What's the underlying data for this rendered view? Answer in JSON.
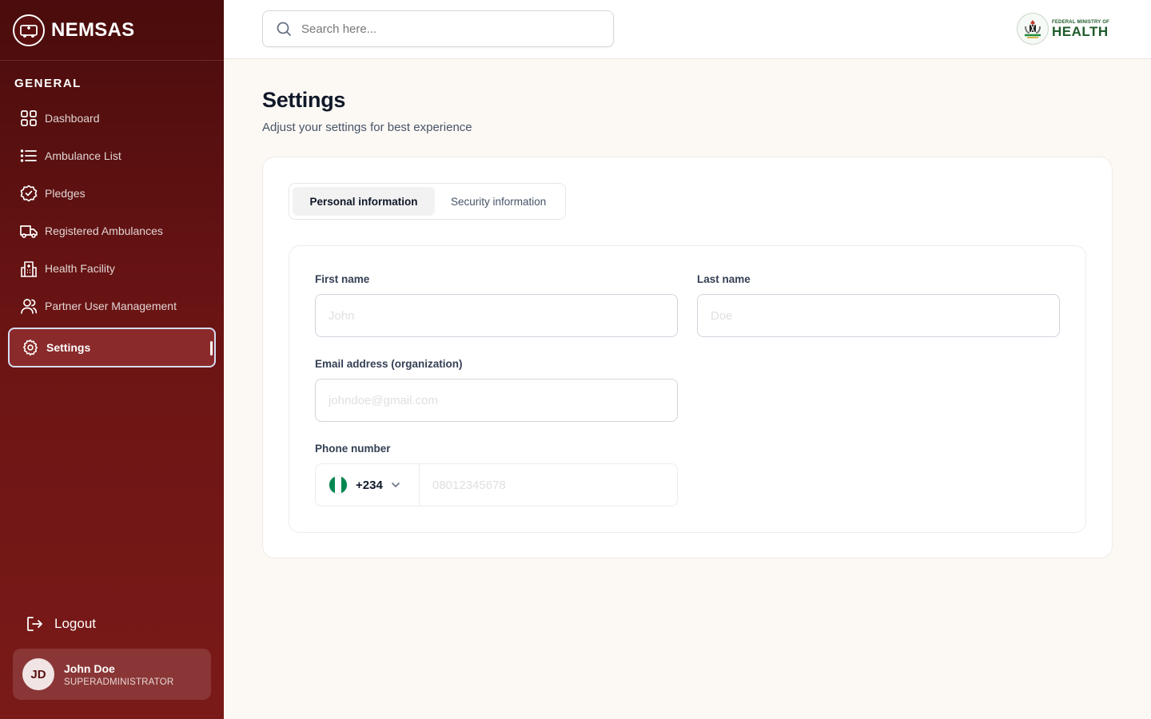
{
  "brand": {
    "name": "NEMSAS"
  },
  "sidebar": {
    "section_title": "GENERAL",
    "items": [
      {
        "label": "Dashboard",
        "icon": "grid-icon"
      },
      {
        "label": "Ambulance List",
        "icon": "list-icon"
      },
      {
        "label": "Pledges",
        "icon": "badge-check-icon"
      },
      {
        "label": "Registered Ambulances",
        "icon": "truck-icon"
      },
      {
        "label": "Health Facility",
        "icon": "building-icon"
      },
      {
        "label": "Partner User Management",
        "icon": "users-icon"
      },
      {
        "label": "Settings",
        "icon": "gear-icon",
        "active": true
      }
    ],
    "logout_label": "Logout",
    "user": {
      "initials": "JD",
      "name": "John Doe",
      "role": "SUPERADMINISTRATOR"
    }
  },
  "header": {
    "search_placeholder": "Search here...",
    "ministry_small": "FEDERAL MINISTRY OF",
    "ministry_big": "HEALTH"
  },
  "page": {
    "title": "Settings",
    "subtitle": "Adjust your settings for best experience",
    "tabs": [
      {
        "label": "Personal information",
        "active": true
      },
      {
        "label": "Security information",
        "active": false
      }
    ],
    "form": {
      "first_name_label": "First name",
      "first_name_placeholder": "John",
      "last_name_label": "Last name",
      "last_name_placeholder": "Doe",
      "email_label": "Email address (organization)",
      "email_placeholder": "johndoe@gmail.com",
      "phone_label": "Phone number",
      "country_code": "+234",
      "phone_placeholder": "08012345678"
    }
  },
  "colors": {
    "sidebar_dark": "#4a0c0c",
    "sidebar_light": "#7a1a18",
    "accent_green": "#1f5b2a",
    "flag_green": "#008751"
  }
}
